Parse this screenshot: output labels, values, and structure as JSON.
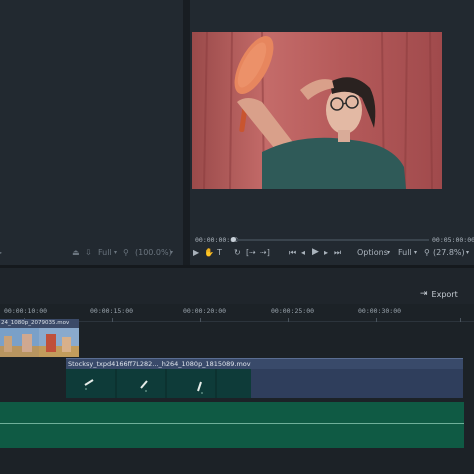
{
  "preview_left": {
    "zoom_mode": "Full",
    "zoom_percent": "(100.0%)"
  },
  "preview_right": {
    "current_time": "00:00:00:00",
    "total_time": "00:05:00:00",
    "options_label": "Options",
    "zoom_mode": "Full",
    "zoom_percent": "(27.8%)"
  },
  "toolbar": {
    "export_label": "Export"
  },
  "ruler": {
    "ticks": [
      "00:00:10:00",
      "00:00:15:00",
      "00:00:20:00",
      "00:00:25:00",
      "00:00:30:00"
    ]
  },
  "clips": [
    {
      "name": "24_1080p_2079035.mov"
    },
    {
      "name": "Stocksy_txpd4166ff7L282..._h264_1080p_1815089.mov"
    }
  ],
  "colors": {
    "progress_accent": "#4a90d9",
    "video_clip": "#394a6a",
    "audio_track": "#0f5a44"
  },
  "icons": [
    "play-icon",
    "hand-tool-icon",
    "text-tool-icon",
    "loop-icon",
    "mark-in-icon",
    "mark-out-icon",
    "skip-back-icon",
    "prev-frame-icon",
    "next-frame-icon",
    "skip-forward-icon",
    "chevron-down-icon",
    "zoom-icon",
    "export-icon"
  ]
}
